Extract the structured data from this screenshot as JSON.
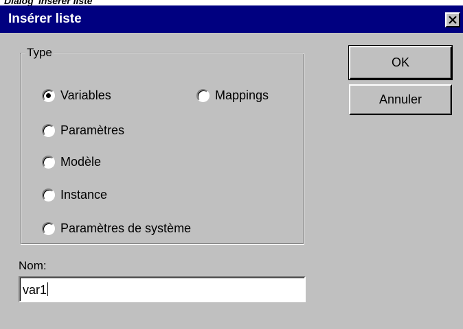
{
  "caption": "Dialog 'Insérer liste'",
  "dialog": {
    "title": "Insérer liste",
    "close_icon": "close-icon"
  },
  "type_group": {
    "legend": "Type",
    "options": [
      {
        "label": "Variables",
        "selected": true
      },
      {
        "label": "Mappings",
        "selected": false
      },
      {
        "label": "Paramètres",
        "selected": false
      },
      {
        "label": "Modèle",
        "selected": false
      },
      {
        "label": "Instance",
        "selected": false
      },
      {
        "label": "Paramètres de système",
        "selected": false
      }
    ]
  },
  "buttons": {
    "ok_label": "OK",
    "cancel_label": "Annuler"
  },
  "name_field": {
    "label": "Nom:",
    "value": "var1"
  },
  "colors": {
    "title_bar": "#000080",
    "dialog_bg": "#c0c0c0"
  }
}
